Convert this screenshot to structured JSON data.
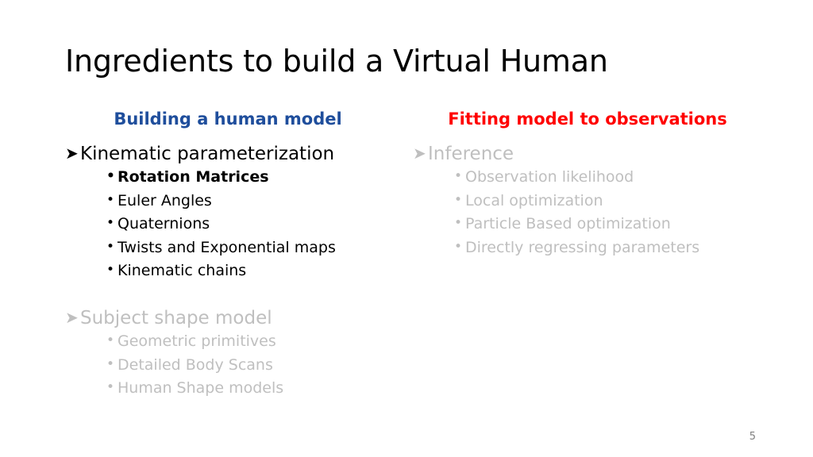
{
  "slide": {
    "title": "Ingredients to build a Virtual Human",
    "page_number": "5",
    "colors": {
      "left_heading": "#1f4e9c",
      "right_heading": "#ff0000",
      "active_text": "#000000",
      "dimmed_text": "#bfbfbf"
    },
    "arrow_glyph": "➤",
    "bullet_glyph": "•",
    "left_column": {
      "heading": "Building a human model",
      "groups": [
        {
          "heading": "Kinematic parameterization",
          "heading_state": "active",
          "items": [
            {
              "label": "Rotation Matrices",
              "state": "active-bold"
            },
            {
              "label": "Euler Angles",
              "state": "active"
            },
            {
              "label": "Quaternions",
              "state": "active"
            },
            {
              "label": "Twists and Exponential maps",
              "state": "active"
            },
            {
              "label": "Kinematic chains",
              "state": "active"
            }
          ]
        },
        {
          "heading": "Subject shape model",
          "heading_state": "dimmed",
          "items": [
            {
              "label": "Geometric primitives",
              "state": "dimmed"
            },
            {
              "label": "Detailed Body Scans",
              "state": "dimmed"
            },
            {
              "label": "Human Shape models",
              "state": "dimmed"
            }
          ]
        }
      ]
    },
    "right_column": {
      "heading": "Fitting model to observations",
      "groups": [
        {
          "heading": "Inference",
          "heading_state": "dimmed",
          "items": [
            {
              "label": "Observation likelihood",
              "state": "dimmed"
            },
            {
              "label": "Local optimization",
              "state": "dimmed"
            },
            {
              "label": "Particle Based optimization",
              "state": "dimmed"
            },
            {
              "label": "Directly regressing parameters",
              "state": "dimmed"
            }
          ]
        }
      ]
    }
  }
}
